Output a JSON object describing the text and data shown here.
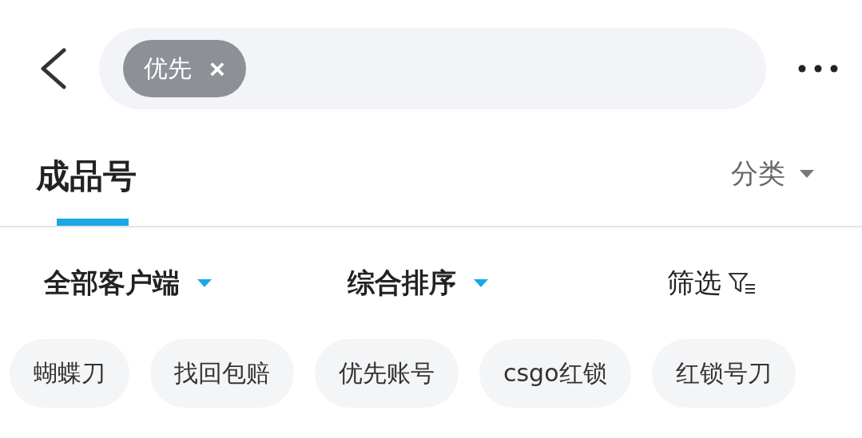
{
  "search": {
    "chips": [
      {
        "label": "优先",
        "remove": "×"
      }
    ]
  },
  "tabs": [
    {
      "label": "成品号",
      "selected": true
    }
  ],
  "category": {
    "label": "分类"
  },
  "filters": [
    {
      "kind": "dropdown",
      "label": "全部客户端"
    },
    {
      "kind": "dropdown",
      "label": "综合排序"
    },
    {
      "kind": "filter",
      "label": "筛选"
    }
  ],
  "tags": [
    "蝴蝶刀",
    "找回包赔",
    "优先账号",
    "csgo红锁",
    "红锁号刀"
  ]
}
